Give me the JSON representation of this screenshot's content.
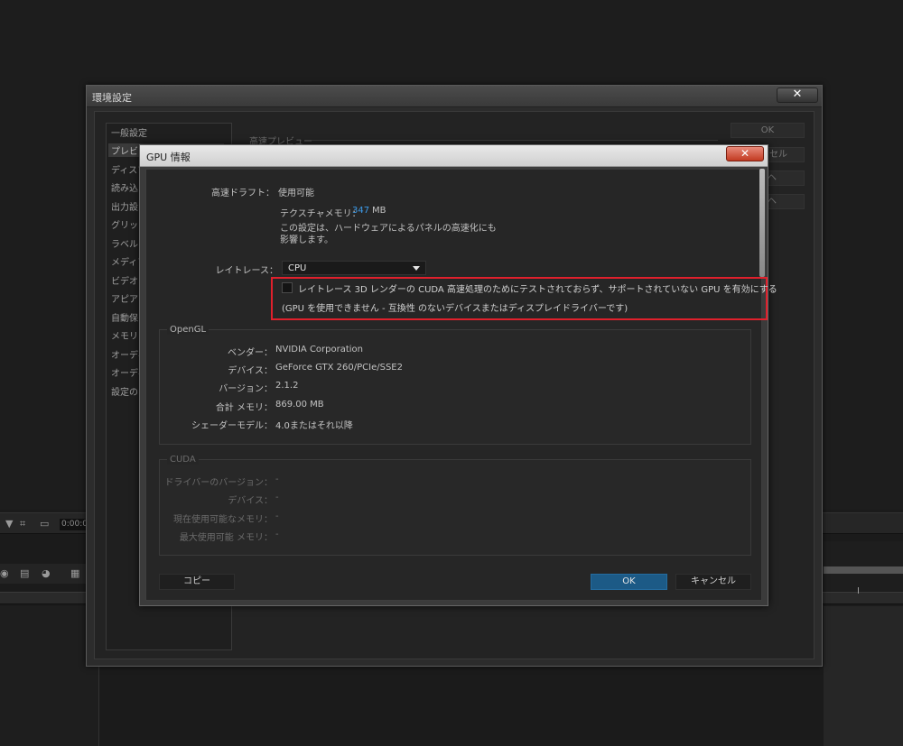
{
  "background": {
    "timecode": "0:00:0",
    "toolbar_icons": [
      "▼",
      "⌗",
      "▭"
    ],
    "row_icons": [
      "◉",
      "▤",
      "◕",
      "▦"
    ]
  },
  "preferences": {
    "title": "環境設定",
    "close_glyph": "✕",
    "categories": [
      {
        "label": "一般設定",
        "selected": false
      },
      {
        "label": "プレビュ",
        "selected": true
      },
      {
        "label": "ディスプ",
        "selected": false
      },
      {
        "label": "読み込",
        "selected": false
      },
      {
        "label": "出力設",
        "selected": false
      },
      {
        "label": "グリッド",
        "selected": false
      },
      {
        "label": "ラベル",
        "selected": false
      },
      {
        "label": "メディア",
        "selected": false
      },
      {
        "label": "ビデオプ",
        "selected": false
      },
      {
        "label": "アピアラ",
        "selected": false
      },
      {
        "label": "自動保",
        "selected": false
      },
      {
        "label": "メモリ",
        "selected": false
      },
      {
        "label": "オーディ",
        "selected": false
      },
      {
        "label": "オーディ",
        "selected": false
      },
      {
        "label": "設定の",
        "selected": false
      }
    ],
    "section_label": "高速プレビュー",
    "ok_label": "OK",
    "cancel_label": "セル",
    "btn3_label": "ヘ",
    "btn4_label": "ヘ"
  },
  "gpu_info": {
    "title": "GPU 情報",
    "close_glyph": "✕",
    "fast_draft": {
      "label": "高速ドラフト：",
      "value": "使用可能"
    },
    "texture_memory": {
      "label": "テクスチャメモリ：",
      "value": "347",
      "unit": "MB"
    },
    "note_line1": "この設定は、ハードウェアによるパネルの高速化にも",
    "note_line2": "影響します。",
    "ray_trace": {
      "label": "レイトレース：",
      "selected": "CPU"
    },
    "checkbox": {
      "checked": false,
      "line1": "レイトレース 3D レンダーの CUDA 高速処理のためにテストされておらず、サポートされていない GPU を有効にする",
      "line2": "(GPU を使用できません - 互換性 のないデバイスまたはディスプレイドライバーです)"
    },
    "opengl": {
      "title": "OpenGL",
      "rows": [
        {
          "label": "ベンダー：",
          "value": "NVIDIA Corporation"
        },
        {
          "label": "デバイス：",
          "value": "GeForce GTX 260/PCIe/SSE2"
        },
        {
          "label": "バージョン：",
          "value": "2.1.2"
        },
        {
          "label": "合計 メモリ：",
          "value": "869.00 MB"
        },
        {
          "label": "シェーダーモデル：",
          "value": "4.0またはそれ以降"
        }
      ]
    },
    "cuda": {
      "title": "CUDA",
      "rows": [
        {
          "label": "ドライバーのバージョン：",
          "value": "-"
        },
        {
          "label": "デバイス：",
          "value": "-"
        },
        {
          "label": "現在使用可能なメモリ：",
          "value": "-"
        },
        {
          "label": "最大使用可能 メモリ：",
          "value": "-"
        }
      ]
    },
    "copy_label": "コピー",
    "ok_label": "OK",
    "cancel_label": "キャンセル"
  }
}
